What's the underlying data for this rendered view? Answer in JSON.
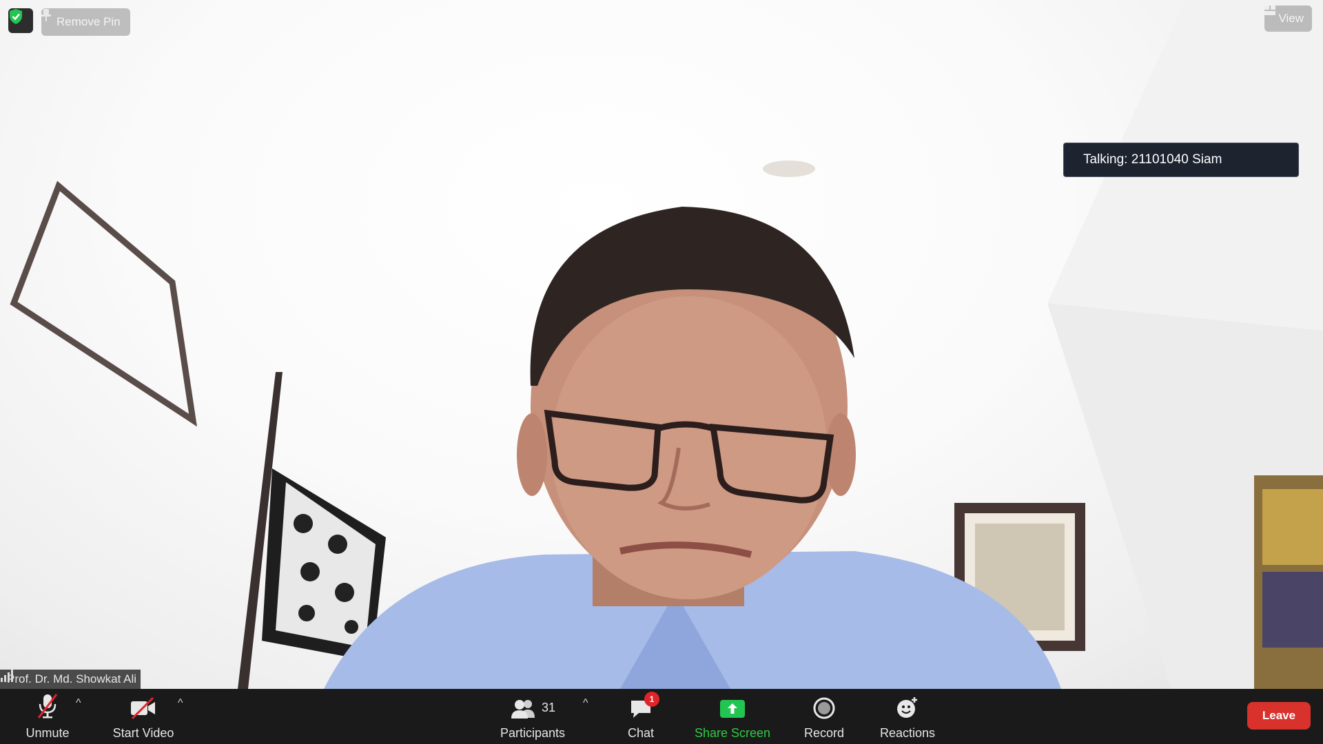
{
  "top": {
    "remove_pin_label": "Remove Pin",
    "view_label": "View"
  },
  "talking_indicator": "Talking: 21101040 Siam",
  "participant_name": "Prof. Dr. Md. Showkat Ali",
  "toolbar": {
    "unmute_label": "Unmute",
    "start_video_label": "Start Video",
    "participants_label": "Participants",
    "participants_count": "31",
    "chat_label": "Chat",
    "chat_badge": "1",
    "share_screen_label": "Share Screen",
    "record_label": "Record",
    "reactions_label": "Reactions",
    "leave_label": "Leave"
  },
  "colors": {
    "share_green": "#2ecc40",
    "leave_red": "#d9312c",
    "toolbar_bg": "#1a1a1a"
  }
}
